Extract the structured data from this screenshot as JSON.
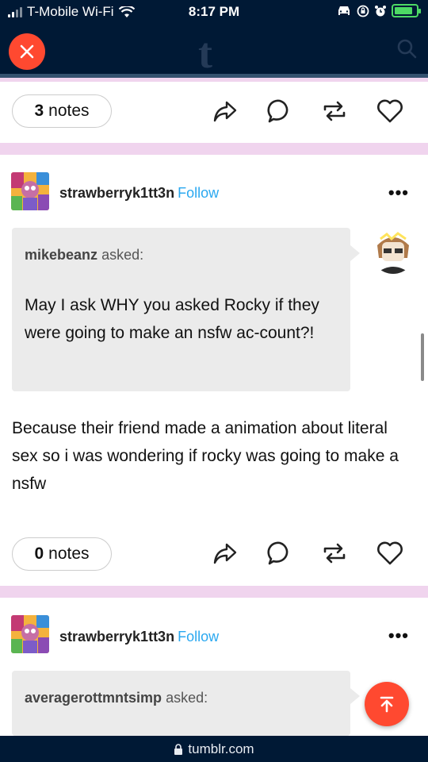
{
  "status_bar": {
    "carrier": "T-Mobile Wi-Fi",
    "time": "8:17 PM",
    "battery_level": 0.85
  },
  "header": {
    "logo": "t",
    "close_icon": "close-icon",
    "search_icon": "search-icon"
  },
  "posts": [
    {
      "notes_count": "3",
      "notes_label": "notes"
    },
    {
      "blog_name": "strawberryk1tt3n",
      "follow_label": "Follow",
      "more_label": "•••",
      "asker": "mikebeanz",
      "asked_label": "asked:",
      "question": "May I ask WHY you asked Rocky if they were going to make an nsfw ac-count?!",
      "answer": "Because their friend made a animation about literal sex so i was wondering if rocky was going to make a nsfw",
      "notes_count": "0",
      "notes_label": "notes"
    },
    {
      "blog_name": "strawberryk1tt3n",
      "follow_label": "Follow",
      "more_label": "•••",
      "asker": "averagerottmntsimp",
      "asked_label": "asked:"
    }
  ],
  "url_bar": {
    "domain": "tumblr.com"
  },
  "colors": {
    "nav_bg": "#001935",
    "accent": "#ff4930",
    "follow": "#2aa8f0",
    "divider_bg": "#f0d4ee"
  }
}
